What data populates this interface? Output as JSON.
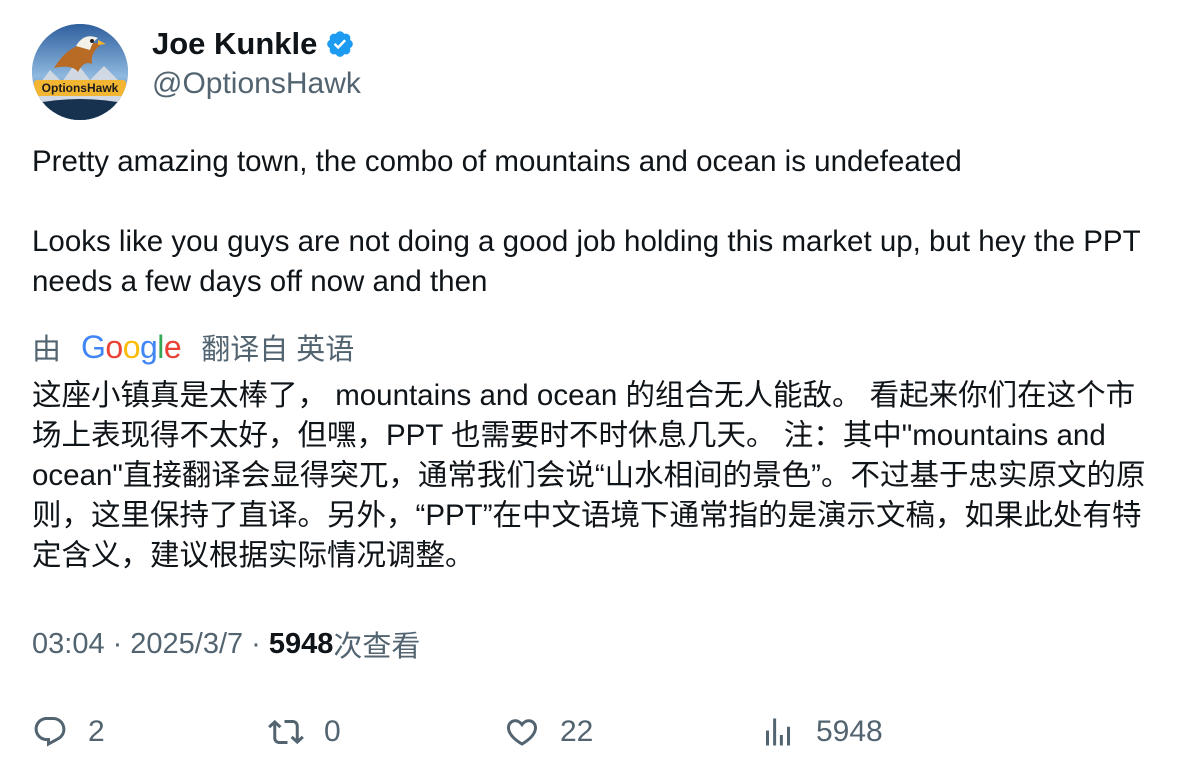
{
  "author": {
    "display_name": "Joe Kunkle",
    "handle": "@OptionsHawk",
    "verified_icon": "verified-badge-icon",
    "avatar_logo_text": "OptionsHawk"
  },
  "tweet": {
    "paragraph_1": "Pretty amazing town, the combo of mountains and ocean is undefeated",
    "paragraph_2": "Looks like you guys are not doing a good job holding this market up, but hey the PPT needs a few days off now and then"
  },
  "translation": {
    "prefix": "由",
    "provider": "Google",
    "suffix": "翻译自 英语",
    "text": "这座小镇真是太棒了， mountains and ocean 的组合无人能敌。 看起来你们在这个市场上表现得不太好，但嘿，PPT 也需要时不时休息几天。 注：其中\"mountains and ocean\"直接翻译会显得突兀，通常我们会说“山水相间的景色”。不过基于忠实原文的原则，这里保持了直译。另外，“PPT”在中文语境下通常指的是演示文稿，如果此处有特定含义，建议根据实际情况调整。"
  },
  "meta": {
    "time": "03:04",
    "separator": "·",
    "date": "2025/3/7",
    "views_count": "5948",
    "views_label": "次查看"
  },
  "actions": {
    "reply_count": "2",
    "retweet_count": "0",
    "like_count": "22",
    "views_count": "5948"
  },
  "colors": {
    "text_primary": "#0f1419",
    "text_secondary": "#536471",
    "verified_blue": "#1d9bf0"
  }
}
